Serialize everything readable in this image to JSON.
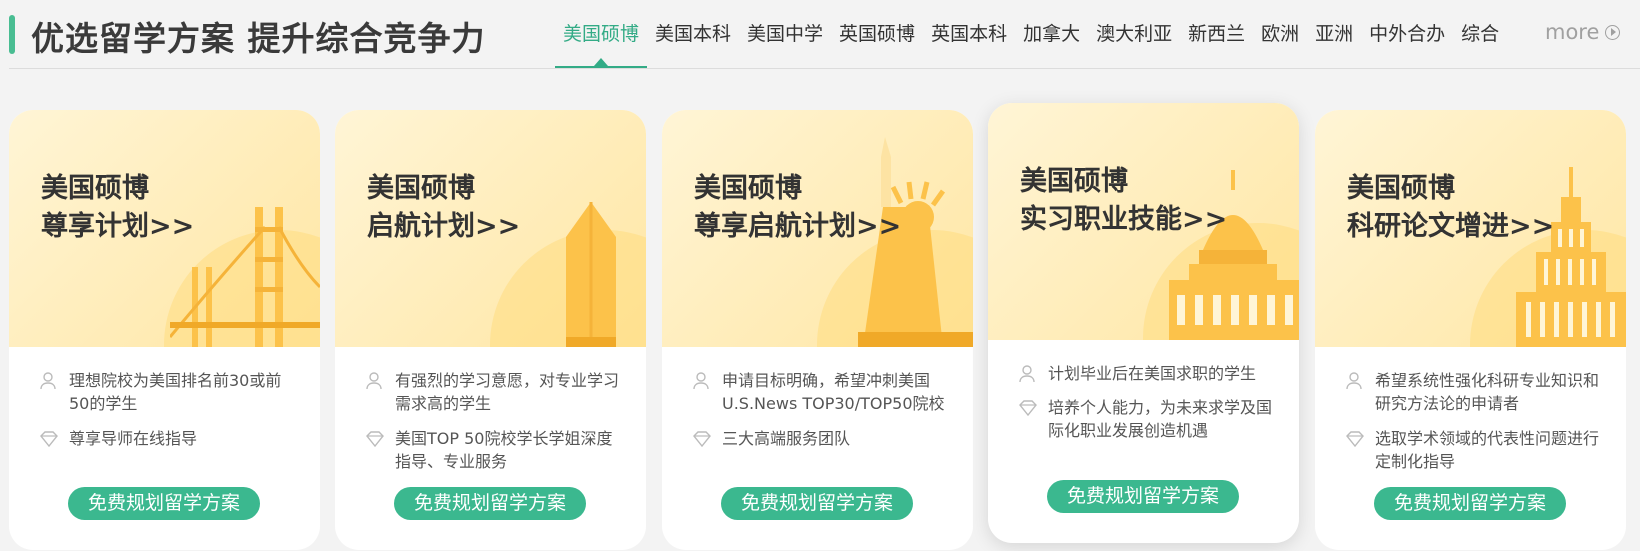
{
  "header": {
    "title": "优选留学方案 提升综合竞争力",
    "tabs": [
      "美国硕博",
      "美国本科",
      "美国中学",
      "英国硕博",
      "英国本科",
      "加拿大",
      "澳大利亚",
      "新西兰",
      "欧洲",
      "亚洲",
      "中外合办",
      "综合"
    ],
    "active_tab": 0,
    "more_label": "more"
  },
  "colors": {
    "accent": "#3bb88f",
    "tab_active": "#33ab86",
    "card_top_from": "#fff5d6",
    "card_top_to": "#ffe6a3"
  },
  "cards": [
    {
      "title_line1": "美国硕博",
      "title_line2": "尊享计划>>",
      "illustration": "golden-gate-bridge",
      "audience": "理想院校为美国排名前30或前50的学生",
      "benefit": "尊享导师在线指导",
      "cta": "免费规划留学方案"
    },
    {
      "title_line1": "美国硕博",
      "title_line2": "启航计划>>",
      "illustration": "tower",
      "audience": "有强烈的学习意愿，对专业学习需求高的学生",
      "benefit": "美国TOP 50院校学长学姐深度指导、专业服务",
      "cta": "免费规划留学方案"
    },
    {
      "title_line1": "美国硕博",
      "title_line2": "尊享启航计划>>",
      "illustration": "statue-of-liberty",
      "audience": "申请目标明确，希望冲刺美国U.S.News TOP30/TOP50院校",
      "benefit": "三大高端服务团队",
      "cta": "免费规划留学方案"
    },
    {
      "title_line1": "美国硕博",
      "title_line2": "实习职业技能>>",
      "illustration": "capitol-building",
      "audience": "计划毕业后在美国求职的学生",
      "benefit": "培养个人能力，为未来求学及国际化职业发展创造机遇",
      "cta": "免费规划留学方案"
    },
    {
      "title_line1": "美国硕博",
      "title_line2": "科研论文增进>>",
      "illustration": "empire-state-building",
      "audience": "希望系统性强化科研专业知识和研究方法论的申请者",
      "benefit": "选取学术领域的代表性问题进行定制化指导",
      "cta": "免费规划留学方案"
    }
  ]
}
